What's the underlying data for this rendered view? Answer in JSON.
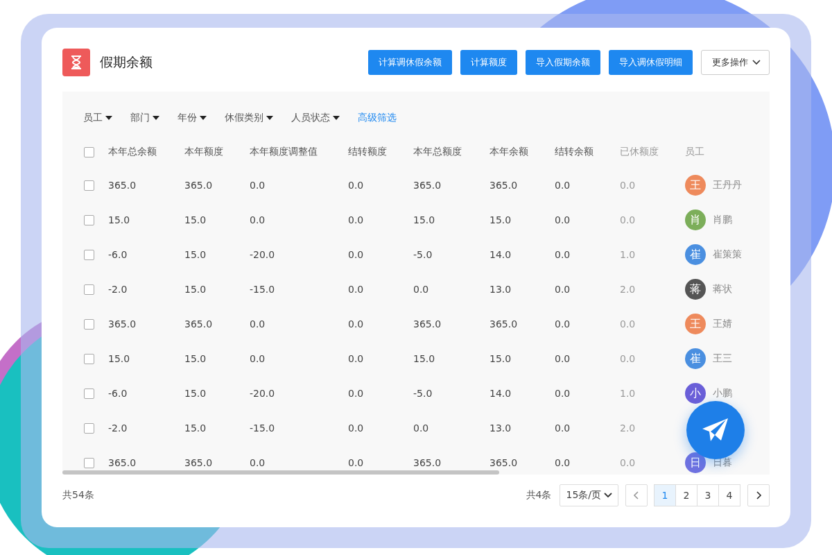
{
  "title": "假期余额",
  "actions": [
    "计算调休假余额",
    "计算额度",
    "导入假期余额",
    "导入调休假明细"
  ],
  "more_button": "更多操作",
  "filters": [
    {
      "label": "员工",
      "kind": "dropdown"
    },
    {
      "label": "部门",
      "kind": "dropdown"
    },
    {
      "label": "年份",
      "kind": "dropdown"
    },
    {
      "label": "休假类别",
      "kind": "dropdown"
    },
    {
      "label": "人员状态",
      "kind": "dropdown"
    },
    {
      "label": "高级筛选",
      "kind": "link"
    }
  ],
  "table": {
    "all_checked": false,
    "columns": [
      "本年总余额",
      "本年额度",
      "本年额度调整值",
      "结转额度",
      "本年总额度",
      "本年余额",
      "结转余额",
      "已休额度",
      "员工"
    ],
    "rows": [
      {
        "checked": false,
        "cells": [
          "365.0",
          "365.0",
          "0.0",
          "0.0",
          "365.0",
          "365.0",
          "0.0",
          "0.0"
        ],
        "employee": {
          "avatar": "王",
          "name": "王丹丹",
          "color": "#ee8a5c"
        }
      },
      {
        "checked": false,
        "cells": [
          "15.0",
          "15.0",
          "0.0",
          "0.0",
          "15.0",
          "15.0",
          "0.0",
          "0.0"
        ],
        "employee": {
          "avatar": "肖",
          "name": "肖鹏",
          "color": "#7cae5a"
        }
      },
      {
        "checked": false,
        "cells": [
          "-6.0",
          "15.0",
          "-20.0",
          "0.0",
          "-5.0",
          "14.0",
          "0.0",
          "1.0"
        ],
        "employee": {
          "avatar": "崔",
          "name": "崔策策",
          "color": "#4a8fe0"
        }
      },
      {
        "checked": false,
        "cells": [
          "-2.0",
          "15.0",
          "-15.0",
          "0.0",
          "0.0",
          "13.0",
          "0.0",
          "2.0"
        ],
        "employee": {
          "avatar": "蒋",
          "name": "蒋状",
          "color": "#555555"
        }
      },
      {
        "checked": false,
        "cells": [
          "365.0",
          "365.0",
          "0.0",
          "0.0",
          "365.0",
          "365.0",
          "0.0",
          "0.0"
        ],
        "employee": {
          "avatar": "王",
          "name": "王婧",
          "color": "#ee8a5c"
        }
      },
      {
        "checked": false,
        "cells": [
          "15.0",
          "15.0",
          "0.0",
          "0.0",
          "15.0",
          "15.0",
          "0.0",
          "0.0"
        ],
        "employee": {
          "avatar": "崔",
          "name": "王三",
          "color": "#4a8fe0"
        }
      },
      {
        "checked": false,
        "cells": [
          "-6.0",
          "15.0",
          "-20.0",
          "0.0",
          "-5.0",
          "14.0",
          "0.0",
          "1.0"
        ],
        "employee": {
          "avatar": "小",
          "name": "小鹏",
          "color": "#6a5fd8"
        }
      },
      {
        "checked": false,
        "cells": [
          "-2.0",
          "15.0",
          "-15.0",
          "0.0",
          "0.0",
          "13.0",
          "0.0",
          "2.0"
        ]
      },
      {
        "checked": false,
        "cells": [
          "365.0",
          "365.0",
          "0.0",
          "0.0",
          "365.0",
          "365.0",
          "0.0",
          "0.0"
        ],
        "employee": {
          "avatar": "日",
          "name": "日暮",
          "color": "#6f72e0"
        }
      }
    ]
  },
  "footer": {
    "total": "共54条",
    "pages_total": "共4条",
    "page_size": "15条/页",
    "pages": [
      {
        "label": "1",
        "selected": true
      },
      {
        "label": "2",
        "selected": false
      },
      {
        "label": "3",
        "selected": false
      },
      {
        "label": "4",
        "selected": false
      }
    ]
  }
}
